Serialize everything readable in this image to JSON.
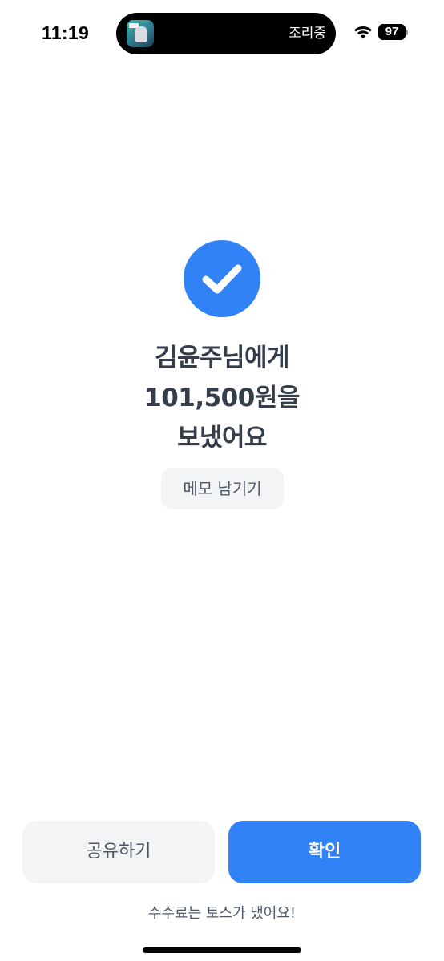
{
  "status_bar": {
    "time": "11:19",
    "live_activity_text": "조리중",
    "wifi_icon": "wifi-icon",
    "battery_level": "97"
  },
  "result": {
    "icon": "checkmark-icon",
    "accent_color": "#3182f6",
    "headline_lines": [
      "김윤주님에게",
      "101,500원을",
      "보냈어요"
    ]
  },
  "memo_button_label": "메모 남기기",
  "actions": {
    "share_label": "공유하기",
    "confirm_label": "확인"
  },
  "fee_note": "수수료는 토스가 냈어요!"
}
